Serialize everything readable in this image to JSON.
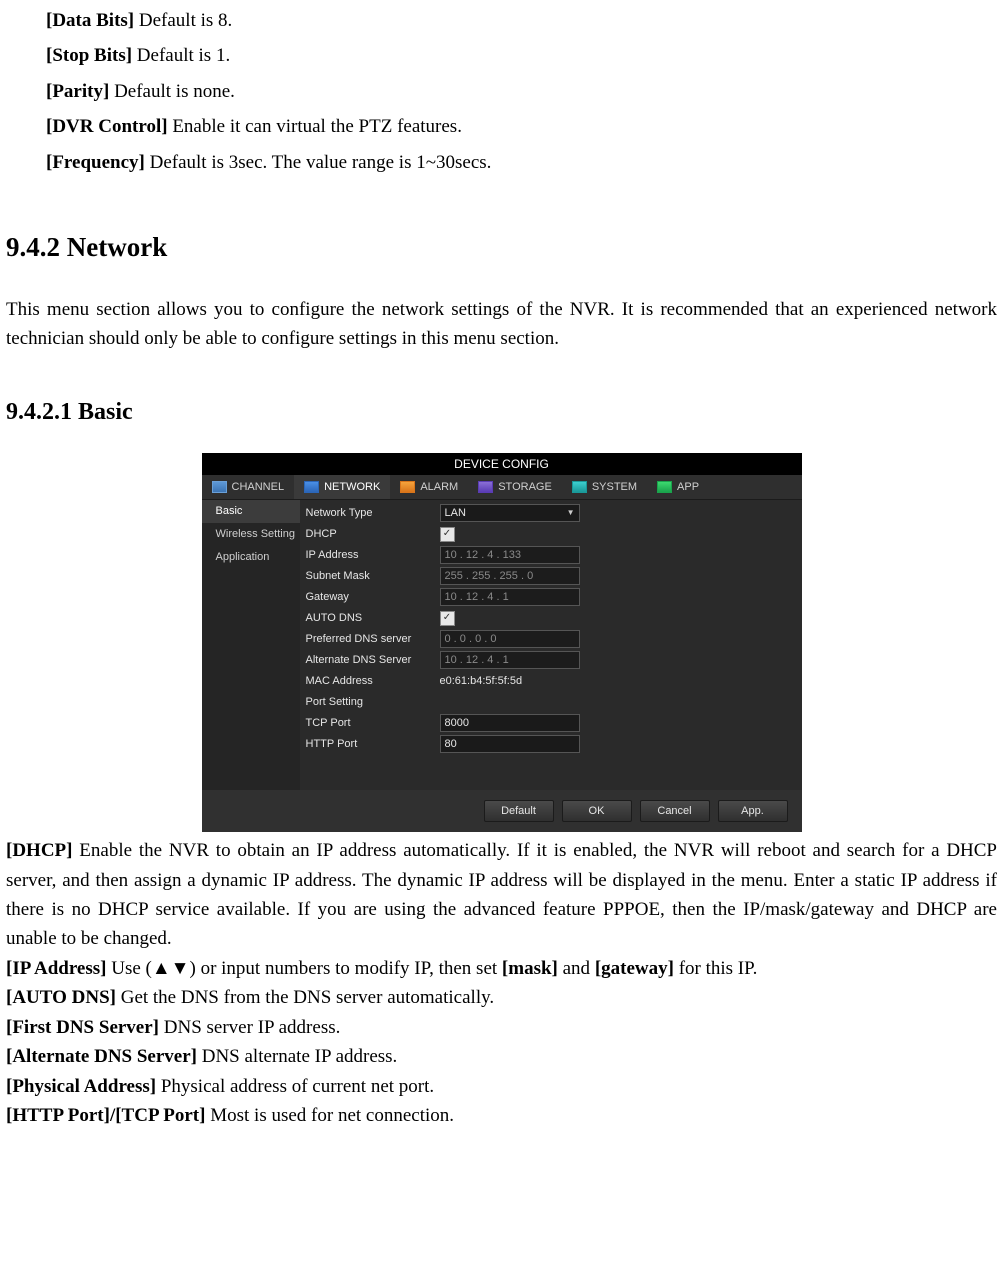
{
  "defs": {
    "databits": {
      "label": "[Data Bits]",
      "text": " Default is 8."
    },
    "stopbits": {
      "label": "[Stop Bits]",
      "text": " Default is 1."
    },
    "parity": {
      "label": "[Parity]",
      "text": " Default is none."
    },
    "dvr": {
      "label": "[DVR Control]",
      "text": " Enable it can virtual the PTZ features."
    },
    "freq": {
      "label": "[Frequency]",
      "text": " Default is 3sec. The value range is 1~30secs."
    }
  },
  "headings": {
    "h942": "9.4.2  Network",
    "h9421": "9.4.2.1 Basic"
  },
  "intro": "This menu section allows you to configure the network settings of the NVR. It is recommended that an experienced network technician should only be able to configure settings in this menu section.",
  "shot": {
    "title": "DEVICE CONFIG",
    "tabs": {
      "channel": "CHANNEL",
      "network": "NETWORK",
      "alarm": "ALARM",
      "storage": "STORAGE",
      "system": "SYSTEM",
      "app": "APP"
    },
    "sidebar": {
      "basic": "Basic",
      "wireless": "Wireless Setting",
      "application": "Application"
    },
    "form": {
      "network_type_label": "Network Type",
      "network_type_value": "LAN",
      "dhcp_label": "DHCP",
      "dhcp_checked": "✓",
      "ip_label": "IP Address",
      "ip_value": "10   . 12   . 4   . 133",
      "mask_label": "Subnet Mask",
      "mask_value": "255  . 255  . 255  . 0",
      "gw_label": "Gateway",
      "gw_value": "10   . 12   . 4   . 1",
      "autodns_label": "AUTO DNS",
      "autodns_checked": "✓",
      "pdns_label": "Preferred DNS server",
      "pdns_value": "0    . 0    . 0    . 0",
      "adns_label": "Alternate DNS Server",
      "adns_value": "10   . 12   . 4   . 1",
      "mac_label": "MAC Address",
      "mac_value": "e0:61:b4:5f:5f:5d",
      "portset_label": "Port Setting",
      "tcp_label": "TCP Port",
      "tcp_value": "8000",
      "http_label": "HTTP Port",
      "http_value": "80"
    },
    "buttons": {
      "default": "Default",
      "ok": "OK",
      "cancel": "Cancel",
      "app": "App."
    }
  },
  "body": {
    "dhcp": {
      "label": "[DHCP]",
      "text": " Enable the NVR to obtain an IP address automatically. If it is enabled, the NVR will reboot and search for a DHCP server, and then assign a dynamic IP address. The dynamic IP address will be displayed in the menu. Enter a static IP address if there is no DHCP service available. If you are using the advanced feature PPPOE, then the IP/mask/gateway and DHCP are unable to be changed."
    },
    "ip": {
      "label": "[IP Address]",
      "pre": " Use (",
      "arrows": "▲▼",
      "mid": ") or input numbers to modify IP, then set ",
      "mask": "[mask]",
      "and": " and ",
      "gw": "[gateway]",
      "post": " for this IP."
    },
    "autodns": {
      "label": "[AUTO DNS]",
      "text": "   Get the DNS from the DNS server automatically."
    },
    "fdns": {
      "label": "[First DNS Server]",
      "text": " DNS server IP address."
    },
    "adns": {
      "label": "[Alternate DNS Server]",
      "text": " DNS alternate IP address."
    },
    "phys": {
      "label": "[Physical Address]",
      "text": " Physical address of current net port."
    },
    "ports": {
      "label": "[HTTP Port]/[TCP Port]",
      "text": " Most is used for net connection."
    }
  }
}
